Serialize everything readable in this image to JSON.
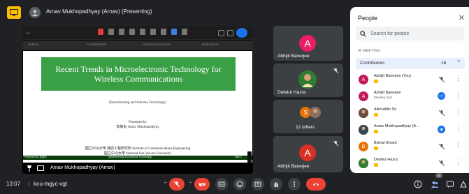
{
  "header": {
    "presenter_label": "Arnav Mukhopadhyay (Arnav) (Presenting)"
  },
  "presentation": {
    "nav_tabs": [
      "Outline",
      "Fundamentals",
      "Advanced Antennas",
      "Applications"
    ],
    "title": "Recent Trends in Microelectronic Technology for Wireless Communications",
    "subtitle": "(Beamforming and Antenna Technology)",
    "presented_by": "Presented by",
    "presenter_line": "安納夫  Arnav Mukhopadhyay",
    "institute_line_1": "國立中山大學 通訊工程研究所  Institute of Communications Engineering",
    "institute_line_2": "國立中山大學  National Sun Yat-sen University",
    "footer_left": "Presented by 安納夫",
    "footer_center": "(Beamforming and Antenna Technology)",
    "footer_right": "May 2",
    "owner_label": "Arnav Mukhopadhyay (Arnav)"
  },
  "tiles": [
    {
      "name": "Abhijit Banerjee",
      "initial": "A",
      "color": "#e91e63"
    },
    {
      "name": "Debdut Hazra",
      "initial": "",
      "color": "#0b8043"
    },
    {
      "name": "12 others",
      "initial": "S",
      "color": "#e8710a"
    },
    {
      "name": "Abhijit Banerjee",
      "initial": "A",
      "color": "#d93025"
    }
  ],
  "people_panel": {
    "title": "People",
    "search_placeholder": "Search for people",
    "section": "IN MEETING",
    "contributors_label": "Contributors",
    "contributors_count": "16",
    "people": [
      {
        "name": "Abhijit Banerjee (You)",
        "sub": "",
        "initial": "A",
        "color": "#c2185b",
        "state": "muted"
      },
      {
        "name": "Abhijit Banerjee",
        "sub": "Meeting host",
        "initial": "A",
        "color": "#c2185b",
        "state": "more"
      },
      {
        "name": "Alimuddin Sk",
        "sub": "",
        "initial": "",
        "color": "#5f6368",
        "state": "muted"
      },
      {
        "name": "Arnav Mukhopadhyay (A...",
        "sub": "",
        "initial": "",
        "color": "#202124",
        "state": "talking"
      },
      {
        "name": "Bishal Ghosh",
        "sub": "",
        "initial": "B",
        "color": "#e8710a",
        "state": "muted"
      },
      {
        "name": "Debdut Hazra",
        "sub": "",
        "initial": "",
        "color": "#0b8043",
        "state": "muted"
      }
    ]
  },
  "footer": {
    "time": "13:07",
    "separator": "|",
    "meeting_code": "kou-mgyc-vgt",
    "people_badge": "16"
  },
  "colors": {
    "background": "#202124",
    "tile": "#3c4043",
    "danger": "#ea4335",
    "accent": "#1a73e8",
    "slide_banner": "#3aa045"
  }
}
